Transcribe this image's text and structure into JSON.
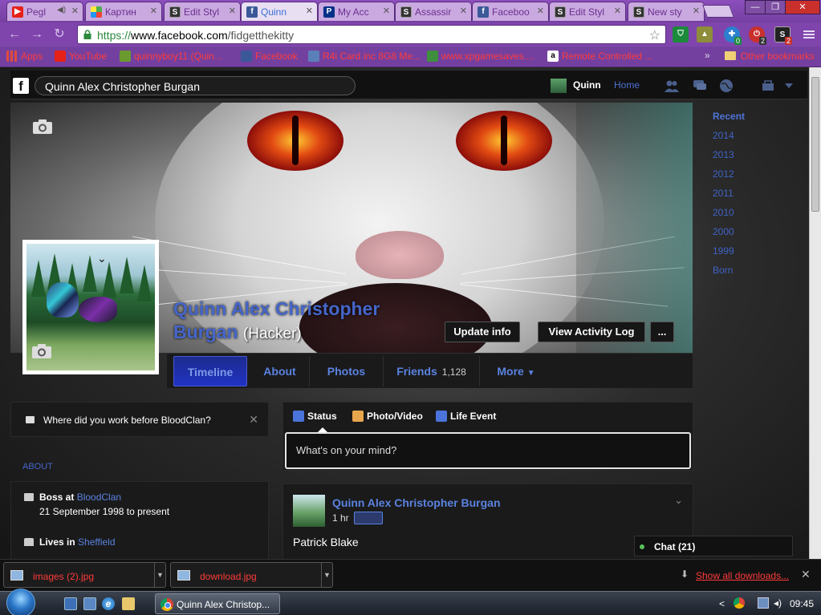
{
  "browser": {
    "tabs": [
      {
        "label": "Pegl",
        "icon": "youtube-icon",
        "color": "#e62117"
      },
      {
        "label": "Картин",
        "icon": "pinwheel-icon",
        "color": "#4caf50"
      },
      {
        "label": "Edit Styl",
        "icon": "stylish-icon",
        "color": "#333333"
      },
      {
        "label": "Quinn",
        "icon": "facebook-icon",
        "color": "#3b5998",
        "active": true
      },
      {
        "label": "My Acc",
        "icon": "paypal-icon",
        "color": "#003087"
      },
      {
        "label": "Assassir",
        "icon": "stylish-icon",
        "color": "#333333"
      },
      {
        "label": "Faceboo",
        "icon": "facebook-icon",
        "color": "#3b5998"
      },
      {
        "label": "Edit Styl",
        "icon": "stylish-icon",
        "color": "#333333"
      },
      {
        "label": "New sty",
        "icon": "stylish-icon",
        "color": "#333333"
      }
    ],
    "url_scheme": "https://",
    "url_host": "www.facebook.com",
    "url_path": "/fidgetthekitty",
    "bookmarks": [
      {
        "label": "Apps",
        "icon": "apps-grid-icon",
        "color": "#e04a3f"
      },
      {
        "label": "YouTube",
        "icon": "youtube-icon",
        "color": "#e62117"
      },
      {
        "label": "quinnyboy11 (Quin...",
        "icon": "xbox-gamertag-icon",
        "color": "#6a9a2e"
      },
      {
        "label": "Facebook",
        "icon": "facebook-icon",
        "color": "#3b5998"
      },
      {
        "label": "R4i Card inc 8G8 Me...",
        "icon": "r4i-icon",
        "color": "#5b7fb8"
      },
      {
        "label": "www.xpgamesaves....",
        "icon": "xpgamesaves-icon",
        "color": "#3e8e3e"
      },
      {
        "label": "Remote Controlled ...",
        "icon": "amazon-icon",
        "color": "#ffffff"
      }
    ],
    "bookmarks_overflow": "»",
    "other_bookmarks": "Other bookmarks",
    "extension_badges": [
      "0",
      "2",
      "2"
    ]
  },
  "facebook": {
    "search_value": "Quinn Alex Christopher Burgan",
    "user_name": "Quinn",
    "home_label": "Home",
    "profile_name": "Quinn Alex Christopher Burgan",
    "nickname": "(Hacker)",
    "update_info": "Update info",
    "view_activity_log": "View Activity Log",
    "more_dots": "...",
    "tabs": {
      "timeline": "Timeline",
      "about": "About",
      "photos": "Photos",
      "friends": "Friends",
      "friends_count": "1,128",
      "more": "More"
    },
    "years": [
      "Recent",
      "2014",
      "2013",
      "2012",
      "2011",
      "2010",
      "2000",
      "1999",
      "Born"
    ],
    "work_prompt": "Where did you work before BloodClan?",
    "about_label": "ABOUT",
    "about": {
      "work_prefix": "Boss at",
      "work_place": "BloodClan",
      "work_dates": "21 September 1998 to present",
      "lives_prefix": "Lives in",
      "lives_place": "Sheffield"
    },
    "composer": {
      "status": "Status",
      "photo_video": "Photo/Video",
      "life_event": "Life Event",
      "placeholder": "What's on your mind?"
    },
    "post": {
      "author": "Quinn Alex Christopher Burgan",
      "time": "1 hr",
      "text": "Patrick Blake"
    },
    "chat": "Chat (21)"
  },
  "downloads": {
    "items": [
      "images (2).jpg",
      "download.jpg"
    ],
    "show_all": "Show all downloads..."
  },
  "taskbar": {
    "window_title": "Quinn Alex Christop...",
    "clock": "09:45"
  }
}
